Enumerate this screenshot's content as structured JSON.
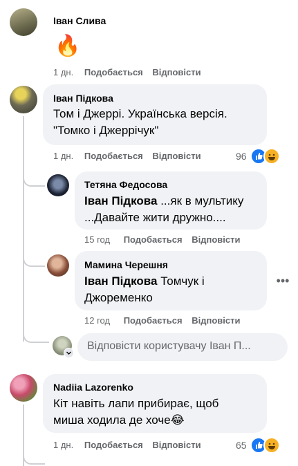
{
  "comments": [
    {
      "author": "Іван Слива",
      "text_emoji": "🔥",
      "time": "1 дн.",
      "like": "Подобається",
      "reply": "Відповісти"
    },
    {
      "author": "Іван Підкова",
      "text_line1": "Том і Джеррі. Українська версія.",
      "text_line2": "\"Томко і Джеррічук\"",
      "time": "1 дн.",
      "like": "Подобається",
      "reply": "Відповісти",
      "reaction_count": "96",
      "replies": [
        {
          "author": "Тетяна Федосова",
          "mention": "Іван Підкова",
          "text_line1": " ...як в мультику",
          "text_line2": "...Давайте жити дружно....",
          "time": "15 год",
          "like": "Подобається",
          "reply": "Відповісти"
        },
        {
          "author": "Мамина Черешня",
          "mention": "Іван Підкова",
          "text_line1": " Томчук і",
          "text_line2": "Джоременко",
          "time": "12 год",
          "like": "Подобається",
          "reply": "Відповісти"
        }
      ],
      "reply_placeholder": "Відповісти користувачу Іван П..."
    },
    {
      "author": "Nadiia Lazorenko",
      "text_line1": "Кіт навіть лапи прибирає, щоб",
      "text_line2": "миша ходила де хоче😂",
      "time": "1 дн.",
      "like": "Подобається",
      "reply": "Відповісти",
      "reaction_count": "65"
    }
  ],
  "colors": {
    "bubble": "#f0f2f5",
    "meta_text": "#65676b",
    "like_blue": "#1877f2",
    "haha_yellow": "#f7b125",
    "thread_line": "#ced0d4"
  }
}
